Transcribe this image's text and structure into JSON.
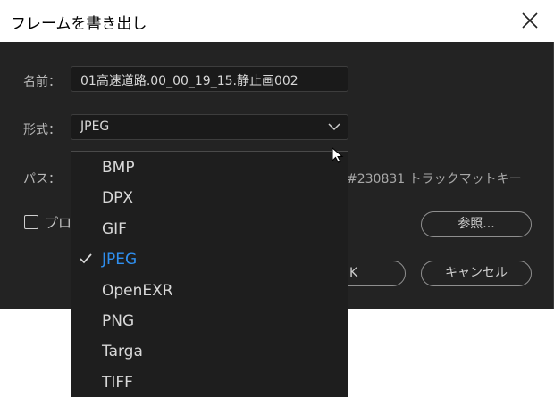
{
  "window": {
    "title": "フレームを書き出し"
  },
  "form": {
    "name_label": "名前：",
    "name_value": "01高速道路.00_00_19_15.静止画002",
    "format_label": "形式：",
    "format_value": "JPEG",
    "path_label": "パス：",
    "path_value_visible": "#230831 トラックマットキー",
    "checkbox_label_visible": "プロ"
  },
  "buttons": {
    "browse": "参照...",
    "ok_visible": "K",
    "cancel": "キャンセル"
  },
  "dropdown": {
    "options": [
      "BMP",
      "DPX",
      "GIF",
      "JPEG",
      "OpenEXR",
      "PNG",
      "Targa",
      "TIFF"
    ],
    "selected": "JPEG"
  },
  "colors": {
    "dialog_bg": "#232323",
    "accent_selected": "#2f8fef"
  }
}
